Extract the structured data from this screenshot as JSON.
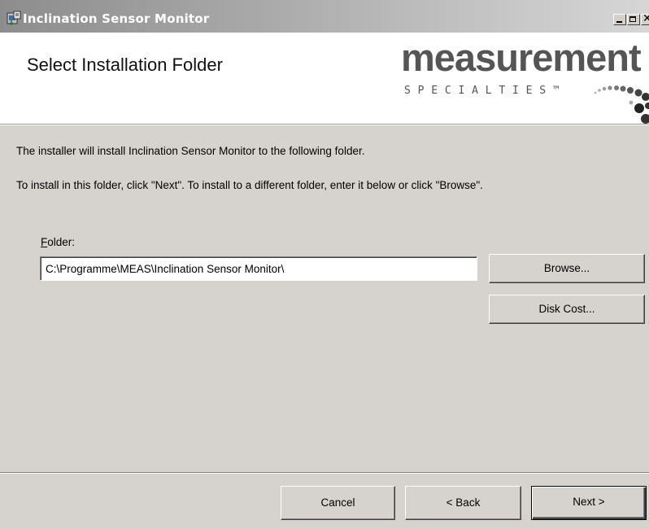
{
  "window": {
    "title": "Inclination Sensor Monitor",
    "icon": "installer-icon",
    "controls": [
      "minimize-icon",
      "maximize-icon",
      "close-icon"
    ]
  },
  "banner": {
    "title": "Select Installation Folder",
    "logo": {
      "word": "measurement",
      "tagline": "SPECIALTIES™",
      "color": "#555555"
    }
  },
  "body": {
    "line1": "The installer will install Inclination Sensor Monitor to the following folder.",
    "line2": "To install in this folder, click \"Next\". To install to a different folder, enter it below or click \"Browse\".",
    "folder": {
      "label_mnemonic": "F",
      "label_rest": "older:",
      "value": "C:\\Programme\\MEAS\\Inclination Sensor Monitor\\"
    },
    "browse_label": "Browse...",
    "disk_cost_label": "Disk Cost..."
  },
  "footer": {
    "cancel_label": "Cancel",
    "back_label": "< Back",
    "next_label": "Next >"
  },
  "colors": {
    "dialog_face": "#d6d3ce",
    "titlebar_start": "#8d8d8d",
    "titlebar_end": "#d6d6d6"
  }
}
